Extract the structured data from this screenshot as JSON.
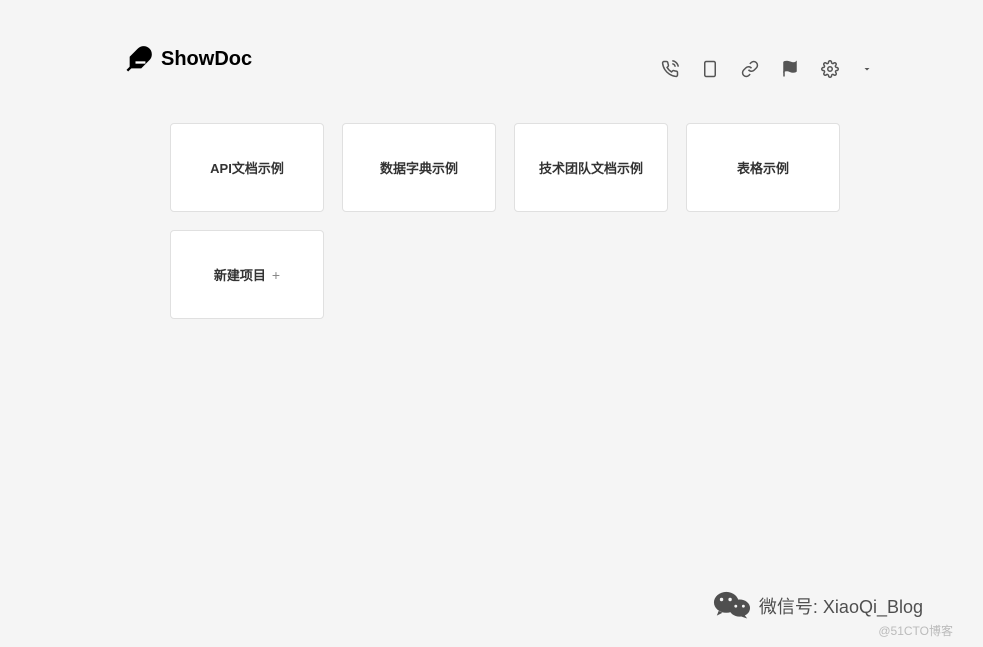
{
  "header": {
    "logo_text": "ShowDoc"
  },
  "projects": [
    {
      "title": "API文档示例"
    },
    {
      "title": "数据字典示例"
    },
    {
      "title": "技术团队文档示例"
    },
    {
      "title": "表格示例"
    }
  ],
  "new_project": {
    "label": "新建项目",
    "plus": "+"
  },
  "watermark": {
    "text": "微信号: XiaoQi_Blog",
    "sub": "@51CTO博客"
  }
}
